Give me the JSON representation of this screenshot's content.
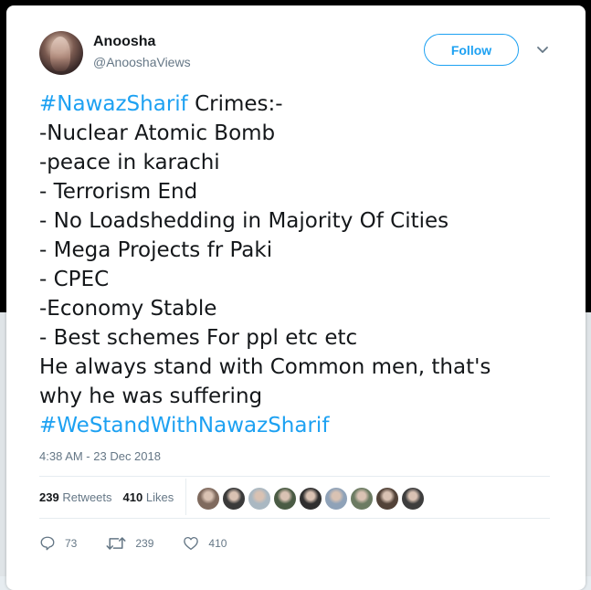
{
  "user": {
    "name": "Anoosha",
    "handle": "@AnooshaViews"
  },
  "follow_button": {
    "label": "Follow"
  },
  "tweet": {
    "lines": [
      {
        "hashtag": "#NawazSharif",
        "text": " Crimes:-"
      },
      {
        "text": "-Nuclear Atomic Bomb"
      },
      {
        "text": "-peace in karachi"
      },
      {
        "text": "- Terrorism End"
      },
      {
        "text": "- No Loadshedding in Majority Of Cities"
      },
      {
        "text": "- Mega Projects fr Paki"
      },
      {
        "text": "- CPEC"
      },
      {
        "text": "-Economy Stable"
      },
      {
        "text": "- Best schemes For ppl etc etc"
      },
      {
        "text": "He always stand with Common men, that's"
      },
      {
        "text": "why he was suffering"
      },
      {
        "hashtag": "#WeStandWithNawazSharif"
      }
    ]
  },
  "timestamp": "4:38 AM - 23 Dec 2018",
  "stats": {
    "retweets_count": "239",
    "retweets_label": "Retweets",
    "likes_count": "410",
    "likes_label": "Likes"
  },
  "liker_avatars": [
    {
      "icon": "liker-avatar",
      "color": "#7f6a5e"
    },
    {
      "icon": "liker-avatar",
      "color": "#3a3a3a"
    },
    {
      "icon": "default-avatar",
      "color": "#aab8c2"
    },
    {
      "icon": "liker-avatar",
      "color": "#4a5b44"
    },
    {
      "icon": "liker-avatar",
      "color": "#2f2f2f"
    },
    {
      "icon": "liker-avatar",
      "color": "#8fa2b8"
    },
    {
      "icon": "liker-avatar",
      "color": "#6c7b62"
    },
    {
      "icon": "liker-avatar",
      "color": "#524238"
    },
    {
      "icon": "liker-avatar",
      "color": "#3d3d3d"
    }
  ],
  "actions": {
    "reply_count": "73",
    "retweet_count": "239",
    "like_count": "410"
  },
  "colors": {
    "accent": "#1da1f2",
    "text": "#14171a",
    "muted": "#657786"
  }
}
